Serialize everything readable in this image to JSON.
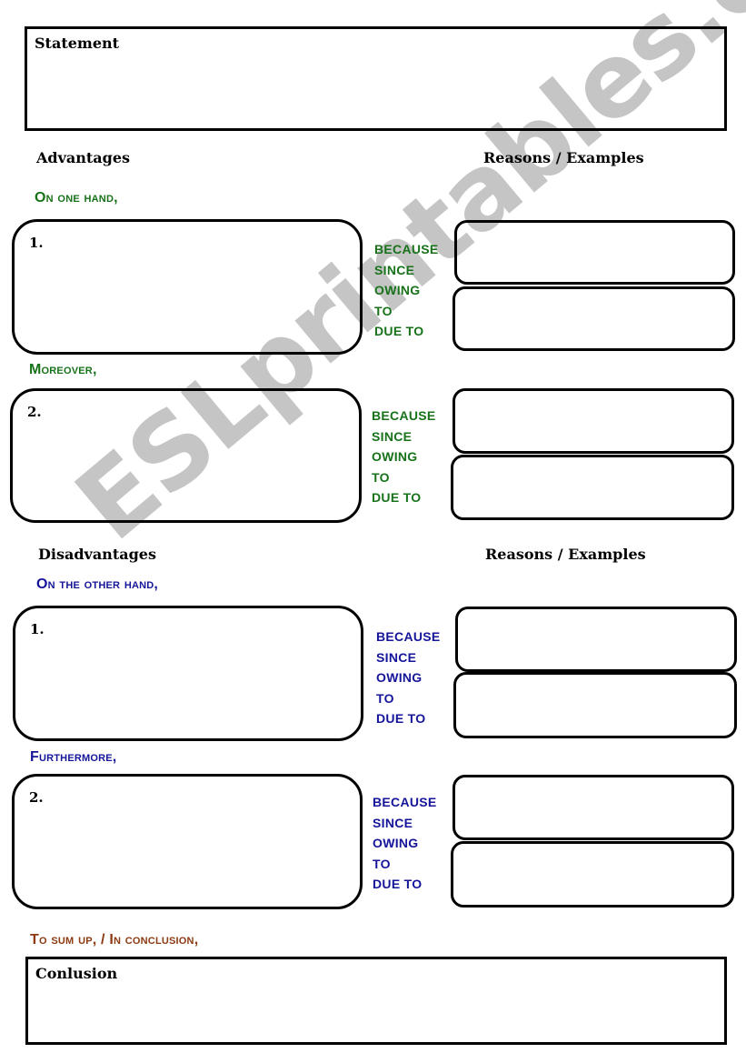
{
  "statement": {
    "label": "Statement"
  },
  "advantages": {
    "heading": "Advantages",
    "reasons_heading": "Reasons / Examples",
    "items": [
      {
        "intro": "On one hand,",
        "number": "1.",
        "connectors": [
          "BECAUSE",
          "SINCE",
          "OWING",
          "TO",
          "DUE TO"
        ]
      },
      {
        "intro": "Moreover,",
        "number": "2.",
        "connectors": [
          "BECAUSE",
          "SINCE",
          "OWING",
          "TO",
          "DUE TO"
        ]
      }
    ]
  },
  "disadvantages": {
    "heading": "Disadvantages",
    "reasons_heading": "Reasons / Examples",
    "items": [
      {
        "intro": "On the other hand,",
        "number": "1.",
        "connectors": [
          "BECAUSE",
          "SINCE",
          "OWING",
          "TO",
          "DUE TO"
        ]
      },
      {
        "intro": "Furthermore,",
        "number": "2.",
        "connectors": [
          "BECAUSE",
          "SINCE",
          "OWING",
          "TO",
          "DUE TO"
        ]
      }
    ]
  },
  "conclusion": {
    "intro": "To sum up, / In conclusion,",
    "label": "Conlusion"
  },
  "watermark": "ESLprintables.com",
  "colors": {
    "advantage_green": "#17721a",
    "disadvantage_blue": "#15159a",
    "conclusion_brown": "#8b3a12"
  }
}
